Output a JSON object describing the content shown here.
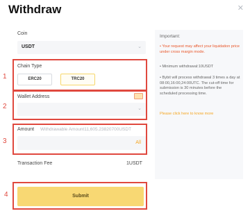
{
  "dialog": {
    "title": "Withdraw",
    "close_icon": "close-icon"
  },
  "coin": {
    "label": "Coin",
    "value": "USDT",
    "chevron": "⌄"
  },
  "annotations": {
    "n1": "1",
    "n2": "2",
    "n3": "3",
    "n4": "4",
    "color": "#e0483e"
  },
  "chain": {
    "label": "Chain Type",
    "options": [
      "ERC20",
      "TRC20"
    ],
    "selected": "TRC20"
  },
  "wallet": {
    "label": "Wallet Address",
    "value": "",
    "chevron": "⌄"
  },
  "amount": {
    "label": "Amount",
    "hint": "Withdrawable Amount11,605.23820700USDT",
    "value": "",
    "all_label": "All"
  },
  "fee": {
    "label": "Transaction Fee",
    "value": "1USDT"
  },
  "submit": {
    "label": "Submit",
    "color": "#f8d873"
  },
  "info": {
    "title": "Important:",
    "bullet1": "• Your request may affect your liquidation price under cross margin mode.",
    "bullet2": "• Minimum withdrawal:10USDT",
    "bullet3": "• Bybit will process withdrawal 3 times a day at 08:00,16:00,24:00UTC. The cut-off time for submission is 30 minutes before the scheduled processing time.",
    "link": "Please click here to know more",
    "warning_color": "#e8572a",
    "link_color": "#f5a623"
  }
}
